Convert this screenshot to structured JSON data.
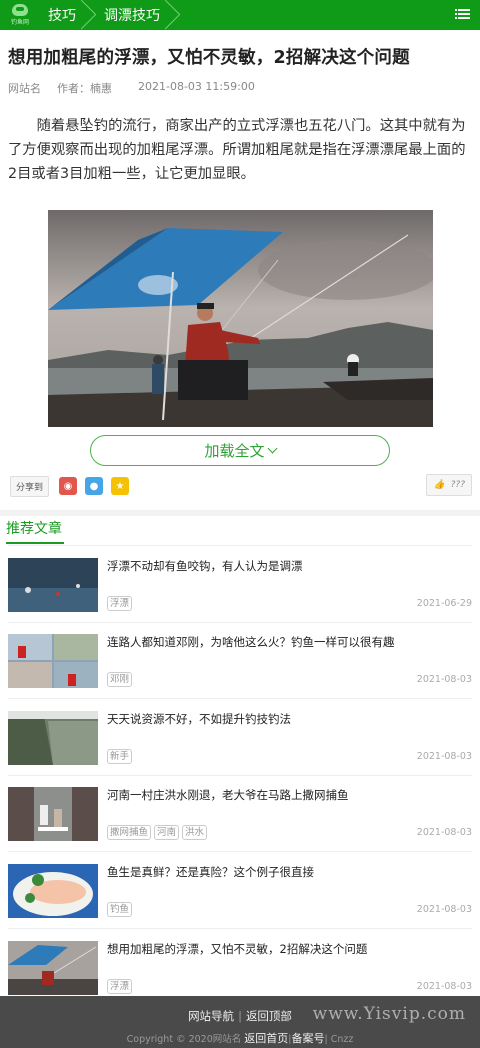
{
  "header": {
    "logo_text": "钓鱼网",
    "breadcrumb": [
      "技巧",
      "调漂技巧"
    ]
  },
  "article": {
    "title": "想用加粗尾的浮漂，又怕不灵敏，2招解决这个问题",
    "site": "网站名",
    "author": "作者：楠惠",
    "datetime": "2021-08-03 11:59:00",
    "intro": "随着悬坠钓的流行，商家出产的立式浮漂也五花八门。这其中就有为了方便观察而出现的加粗尾浮漂。所谓加粗尾就是指在浮漂漂尾最上面的2目或者3目加粗一些，让它更加显眼。",
    "load_more": "加载全文",
    "share_label": "分享到",
    "like_count": "???"
  },
  "recommend": {
    "heading": "推荐文章",
    "items": [
      {
        "title": "浮漂不动却有鱼咬钩，有人认为是调漂",
        "tags": [
          "浮漂"
        ],
        "date": "2021-06-29"
      },
      {
        "title": "连路人都知道邓刚，为啥他这么火？钓鱼一样可以很有趣",
        "tags": [
          "邓刚"
        ],
        "date": "2021-08-03"
      },
      {
        "title": "天天说资源不好，不如提升钓技钓法",
        "tags": [
          "新手"
        ],
        "date": "2021-08-03"
      },
      {
        "title": "河南一村庄洪水刚退，老大爷在马路上撒网捕鱼",
        "tags": [
          "撒网捕鱼",
          "河南",
          "洪水"
        ],
        "date": "2021-08-03"
      },
      {
        "title": "鱼生是真鲜？还是真险？这个例子很直接",
        "tags": [
          "钓鱼"
        ],
        "date": "2021-08-03"
      },
      {
        "title": "想用加粗尾的浮漂，又怕不灵敏，2招解决这个问题",
        "tags": [
          "浮漂"
        ],
        "date": "2021-08-03"
      }
    ]
  },
  "footer": {
    "nav": "网站导航",
    "back_top": "返回顶部",
    "copyright": "Copyright © 2020网站名",
    "home": "返回首页",
    "icp": "备案号",
    "cnzz": "Cnzz"
  },
  "watermark": "www.Yisvip.com",
  "colors": {
    "brand": "#0f9a17",
    "accent": "#1c9b22",
    "footer": "#4a4a4a"
  }
}
